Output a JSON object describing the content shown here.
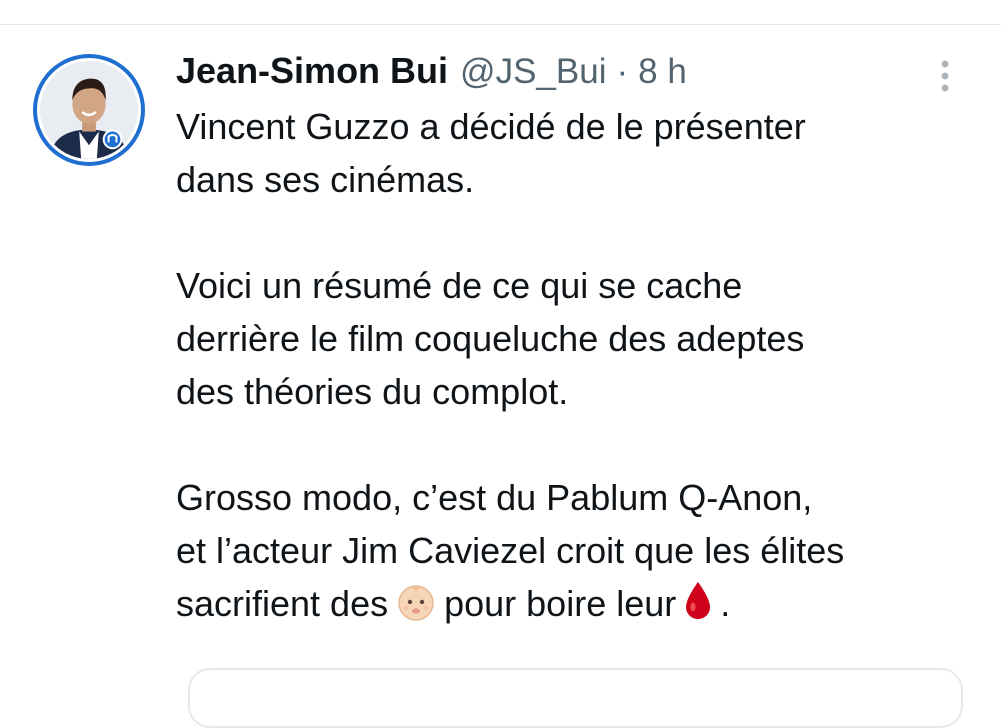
{
  "author": {
    "display_name": "Jean-Simon Bui",
    "handle": "@JS_Bui",
    "separator": "·",
    "time": "8 h"
  },
  "tweet": {
    "p1_line1": "Vincent Guzzo a décidé de le présenter",
    "p1_line2": "dans ses cinémas.",
    "p2_line1": "Voici un résumé de ce qui se cache",
    "p2_line2": "derrière le film coqueluche des adeptes",
    "p2_line3": "des théories du complot.",
    "p3_line1": "Grosso modo, c’est du Pablum Q-Anon,",
    "p3_line2": "et l’acteur Jim Caviezel croit que les élites",
    "p3_line3_before": "sacrifient des",
    "p3_line3_middle": "pour boire leur",
    "p3_line3_end": ".",
    "emoji_1": "baby-emoji",
    "emoji_2": "blood-drop-emoji"
  },
  "colors": {
    "text": "#0f1419",
    "secondary_text": "#536471",
    "divider": "#e6e9ec",
    "avatar_ring": "#1f6fd1",
    "blood": "#d0021b"
  },
  "icons": {
    "more": "more-vertical-icon"
  }
}
